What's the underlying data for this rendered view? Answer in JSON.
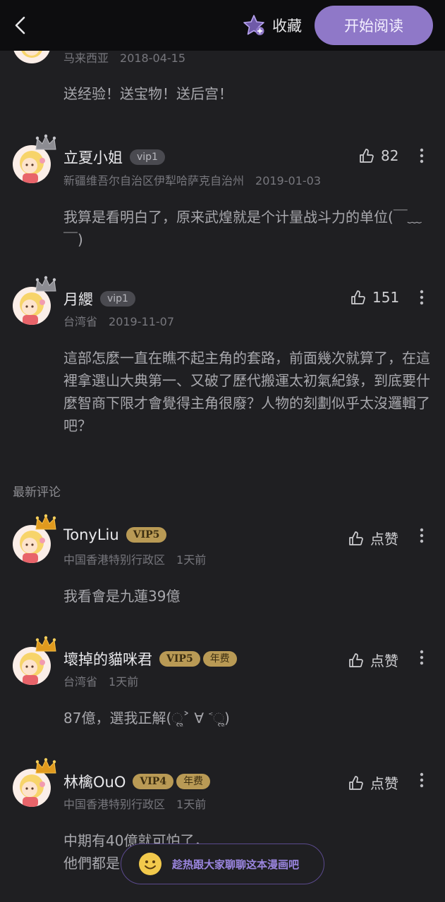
{
  "header": {
    "favorite_label": "收藏",
    "start_reading_label": "开始阅读",
    "accent": "#8f78c8"
  },
  "first_comment": {
    "location": "马来西亚",
    "date": "2018-04-15",
    "text": "送经验！送宝物！送后宫！"
  },
  "hot_comments": [
    {
      "username": "立夏小姐",
      "badge": "vip1",
      "location": "新疆维吾尔自治区伊犁哈萨克自治州",
      "date": "2019-01-03",
      "likes": "82",
      "text": "我算是看明白了，原来武煌就是个计量战斗力的单位(￣﹏￣)"
    },
    {
      "username": "月纓",
      "badge": "vip1",
      "location": "台湾省",
      "date": "2019-11-07",
      "likes": "151",
      "text": "這部怎麼一直在瞧不起主角的套路，前面幾次就算了，在這裡拿選山大典第一、又破了歷代搬運太初氣紀錄，到底要什麼智商下限才會覺得主角很廢？人物的刻劃似乎太沒邏輯了吧？"
    }
  ],
  "latest_section_title": "最新评论",
  "latest_comments": [
    {
      "username": "TonyLiu",
      "vip": "VIP5",
      "annual": "",
      "location": "中国香港特别行政区",
      "date": "1天前",
      "like_label": "点赞",
      "text": "我看會是九蓮39億"
    },
    {
      "username": "壞掉的貓咪君",
      "vip": "VIP5",
      "annual": "年费",
      "location": "台湾省",
      "date": "1天前",
      "like_label": "点赞",
      "text": "87億，選我正解(ૢ˃ ∀ ˂ૢ)"
    },
    {
      "username": "林檎OuO",
      "vip": "VIP4",
      "annual": "年费",
      "location": "中国香港特别行政区",
      "date": "1天前",
      "like_label": "点赞",
      "text_line1": "中期有40億就可怕了，",
      "text_line2": "他們都是"
    }
  ],
  "chat_bar": {
    "label": "趁热跟大家聊聊这本漫画吧",
    "icon": "smiley-icon"
  }
}
